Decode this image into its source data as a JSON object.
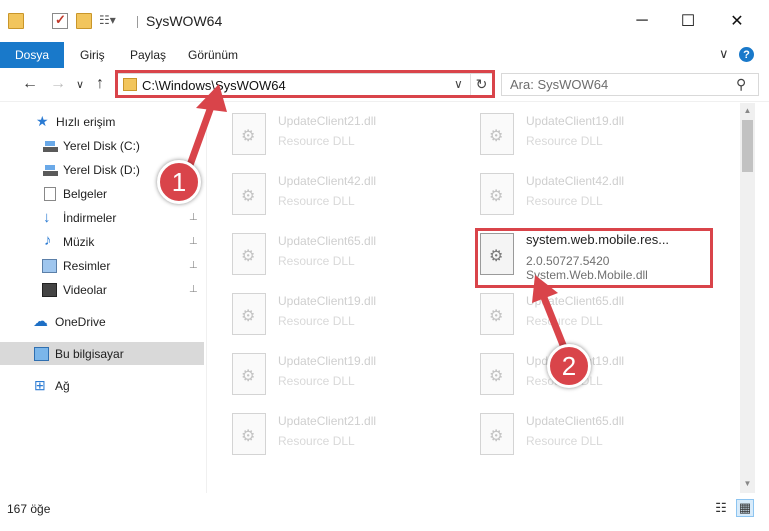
{
  "window": {
    "title": "SysWOW64",
    "minimize": "─",
    "maximize": "☐",
    "close": "✕"
  },
  "ribbon": {
    "tabs": [
      "Dosya",
      "Giriş",
      "Paylaş",
      "Görünüm"
    ],
    "expand": "∨",
    "help": "?"
  },
  "address": {
    "back": "←",
    "forward": "→",
    "recent": "∨",
    "up": "↑",
    "path": "C:\\Windows\\SysWOW64",
    "dropdown": "∨",
    "refresh": "↻"
  },
  "search": {
    "placeholder": "Ara: SysWOW64",
    "icon": "search-icon"
  },
  "sidebar": {
    "items": [
      {
        "label": "Hızlı erişim",
        "icon": "star-icon"
      },
      {
        "label": "Yerel Disk (C:)",
        "icon": "drive-icon"
      },
      {
        "label": "Yerel Disk (D:)",
        "icon": "drive-icon"
      },
      {
        "label": "Belgeler",
        "icon": "document-icon"
      },
      {
        "label": "İndirmeler",
        "icon": "download-icon"
      },
      {
        "label": "Müzik",
        "icon": "music-icon"
      },
      {
        "label": "Resimler",
        "icon": "picture-icon"
      },
      {
        "label": "Videolar",
        "icon": "video-icon"
      },
      {
        "label": "OneDrive",
        "icon": "cloud-icon"
      },
      {
        "label": "Bu bilgisayar",
        "icon": "computer-icon"
      },
      {
        "label": "Ağ",
        "icon": "network-icon"
      }
    ],
    "pin": "📌"
  },
  "files": [
    {
      "name": "UpdateClient21.dll",
      "sub": "Resource DLL"
    },
    {
      "name": "UpdateClient19.dll",
      "sub": "Resource DLL"
    },
    {
      "name": "UpdateClient42.dll",
      "sub": "Resource DLL"
    },
    {
      "name": "UpdateClient42.dll",
      "sub": "Resource DLL"
    },
    {
      "name": "UpdateClient65.dll",
      "sub": "Resource DLL"
    },
    {
      "name": "system.web.mobile.res...",
      "sub": "2.0.50727.5420",
      "sub2": "System.Web.Mobile.dll"
    },
    {
      "name": "UpdateClient19.dll",
      "sub": "Resource DLL"
    },
    {
      "name": "UpdateClient65.dll",
      "sub": "Resource DLL"
    },
    {
      "name": "UpdateClient19.dll",
      "sub": "Resource DLL"
    },
    {
      "name": "UpdateClient19.dll",
      "sub": "Resource DLL"
    },
    {
      "name": "UpdateClient21.dll",
      "sub": "Resource DLL"
    },
    {
      "name": "UpdateClient65.dll",
      "sub": "Resource DLL"
    }
  ],
  "status": {
    "count": "167 öğe"
  },
  "annotations": {
    "step1": "1",
    "step2": "2",
    "color": "#d9444a"
  }
}
